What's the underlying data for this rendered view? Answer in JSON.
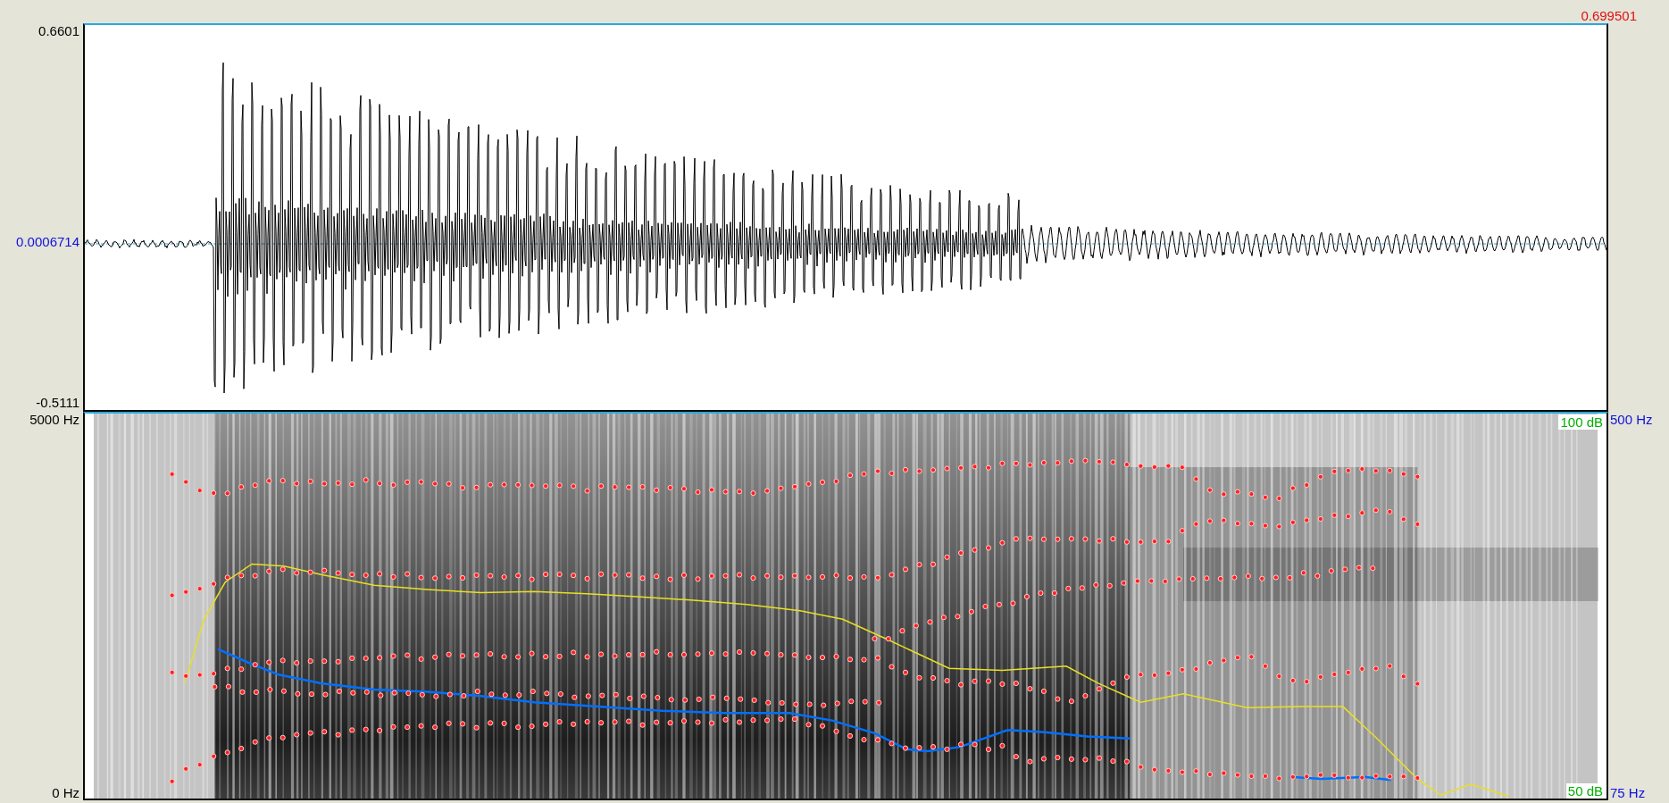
{
  "time_end": "0.699501",
  "waveform": {
    "max_label": "0.6601",
    "cursor_label": "0.0006714",
    "min_label": "-0.5111"
  },
  "spectrogram": {
    "max_freq": "5000 Hz",
    "min_freq": "0 Hz",
    "intensity_max": "100 dB",
    "intensity_min": "50 dB",
    "pitch_max": "500 Hz",
    "pitch_min": "75 Hz"
  }
}
